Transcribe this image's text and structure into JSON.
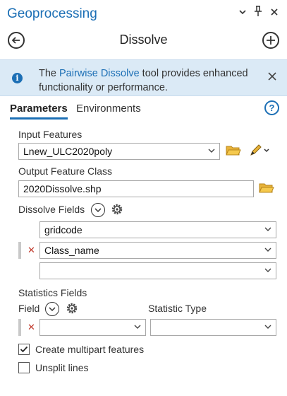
{
  "window": {
    "title": "Geoprocessing",
    "controls": {
      "dropdown": "⌄",
      "pin": "📌",
      "close": "✕"
    }
  },
  "header": {
    "tool_title": "Dissolve"
  },
  "banner": {
    "text_before": "The ",
    "link_text": "Pairwise Dissolve",
    "text_after": " tool provides enhanced functionality or performance."
  },
  "tabs": [
    {
      "label": "Parameters",
      "active": true
    },
    {
      "label": "Environments",
      "active": false
    }
  ],
  "params": {
    "input_features": {
      "label": "Input Features",
      "value": "Lnew_ULC2020poly"
    },
    "output_class": {
      "label": "Output Feature Class",
      "value": "2020Dissolve.shp"
    },
    "dissolve_fields": {
      "label": "Dissolve Fields",
      "rows": [
        {
          "value": "gridcode"
        },
        {
          "value": "Class_name"
        },
        {
          "value": ""
        }
      ]
    },
    "statistics_fields": {
      "label": "Statistics Fields",
      "field_col": "Field",
      "type_col": "Statistic Type",
      "row": {
        "field": "",
        "type": ""
      }
    },
    "create_multipart": {
      "label": "Create multipart features",
      "checked": true
    },
    "unsplit_lines": {
      "label": "Unsplit lines",
      "checked": false
    }
  },
  "colors": {
    "accent": "#1c6fb5",
    "banner_bg": "#dbeaf6",
    "remove_x": "#c0392b"
  }
}
